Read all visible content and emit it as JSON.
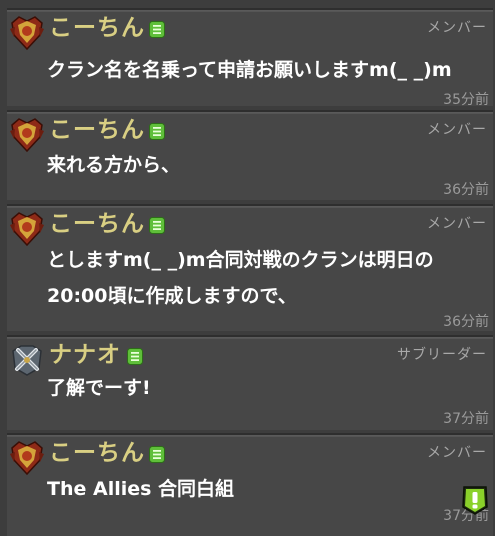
{
  "messages": [
    {
      "name": "こーちん",
      "role": "メンバー",
      "text": [
        "クラン名を名乗って申請お願いしますm(_ _)m"
      ],
      "time": "35分前",
      "avatar": "clan-badge-red-icon"
    },
    {
      "name": "こーちん",
      "role": "メンバー",
      "text": [
        "来れる方から、"
      ],
      "time": "36分前",
      "avatar": "clan-badge-red-icon"
    },
    {
      "name": "こーちん",
      "role": "メンバー",
      "text": [
        "としますm(_ _)m合同対戦のクランは明日の",
        "20:00頃に作成しますので、"
      ],
      "time": "36分前",
      "avatar": "clan-badge-red-icon"
    },
    {
      "name": "ナナオ",
      "role": "サブリーダー",
      "text": [
        "了解でーす!"
      ],
      "time": "37分前",
      "avatar": "crossed-swords-icon"
    },
    {
      "name": "こーちん",
      "role": "メンバー",
      "text": [
        "The Allies 合同白組"
      ],
      "time": "37分前",
      "avatar": "clan-badge-red-icon"
    }
  ],
  "colors": {
    "background": "#3d3d3d",
    "name": "#d9cf83",
    "message_text": "#ffffff",
    "role": "#a8a8a8",
    "time": "#9a9a9a",
    "chat_icon": "#5fbf3a",
    "alert": "#8ad12a"
  },
  "icons": {
    "chat": "chat-bubble-icon",
    "alert": "exclamation-alert-icon"
  }
}
